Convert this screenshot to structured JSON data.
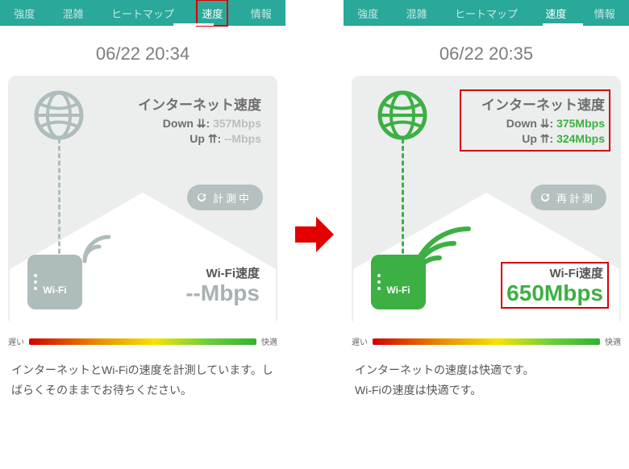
{
  "tabs": {
    "strength": "強度",
    "congestion": "混雑",
    "heatmap": "ヒートマップ",
    "speed": "速度",
    "info": "情報"
  },
  "meter": {
    "slow": "遅い",
    "fast": "快適"
  },
  "wifi_badge_text": "Wi-Fi",
  "left": {
    "timestamp": "06/22 20:34",
    "net_title": "インターネット速度",
    "down_lbl": "Down ⇊:",
    "down_val": "357Mbps",
    "up_lbl": "Up ⇈:",
    "up_val": "--Mbps",
    "btn": "計測中",
    "wifi_title": "Wi-Fi速度",
    "wifi_val": "--Mbps",
    "status": "インターネットとWi-Fiの速度を計測しています。しばらくそのままでお待ちください。"
  },
  "right": {
    "timestamp": "06/22 20:35",
    "net_title": "インターネット速度",
    "down_lbl": "Down ⇊:",
    "down_val": "375Mbps",
    "up_lbl": "Up ⇈:",
    "up_val": "324Mbps",
    "btn": "再計測",
    "wifi_title": "Wi-Fi速度",
    "wifi_val": "650Mbps",
    "status": "インターネットの速度は快適です。\nWi-Fiの速度は快適です。"
  },
  "colors": {
    "header": "#2aa89a",
    "highlight": "#d60000",
    "green": "#3cb043",
    "gray": "#aebcbc"
  }
}
